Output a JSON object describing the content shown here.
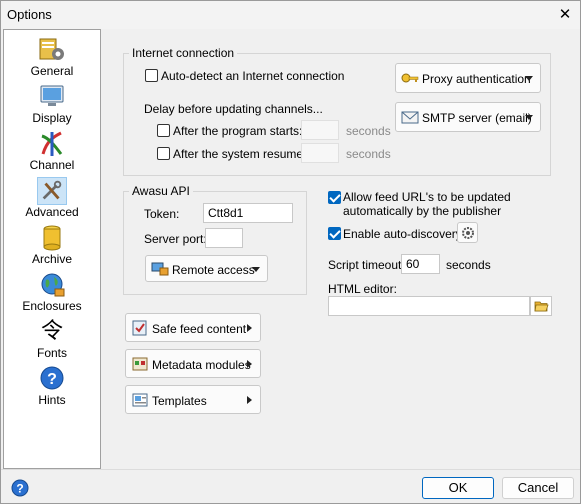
{
  "window": {
    "title": "Options"
  },
  "sidebar": {
    "items": [
      {
        "label": "General",
        "icon": "gear-folder-icon"
      },
      {
        "label": "Display",
        "icon": "monitor-icon"
      },
      {
        "label": "Channel",
        "icon": "channel-icon"
      },
      {
        "label": "Advanced",
        "icon": "tools-icon",
        "selected": true
      },
      {
        "label": "Archive",
        "icon": "archive-icon"
      },
      {
        "label": "Enclosures",
        "icon": "globe-icon"
      },
      {
        "label": "Fonts",
        "icon": "font-icon"
      },
      {
        "label": "Hints",
        "icon": "question-icon"
      }
    ]
  },
  "internet": {
    "group_label": "Internet connection",
    "autodetect_label": "Auto-detect an Internet connection",
    "delay_label": "Delay before updating channels...",
    "after_start_label": "After the program starts:",
    "after_resume_label": "After the system resumes:",
    "seconds_label": "seconds",
    "proxy_button": "Proxy authentication",
    "smtp_button": "SMTP server (email)"
  },
  "awasu_api": {
    "group_label": "Awasu API",
    "token_label": "Token:",
    "token_value": "Ctt8d1",
    "port_label": "Server port:",
    "port_value": "",
    "remote_button": "Remote access"
  },
  "options": {
    "allow_feed_label_line1": "Allow feed URL's to be updated",
    "allow_feed_label_line2": "automatically by the publisher",
    "autodiscovery_label": "Enable auto-discovery",
    "script_timeout_label": "Script timeout:",
    "script_timeout_value": "60",
    "seconds_label": "seconds",
    "html_editor_label": "HTML editor:",
    "html_editor_value": ""
  },
  "menus": {
    "safe_feed": "Safe feed content",
    "metadata": "Metadata modules",
    "templates": "Templates"
  },
  "footer": {
    "ok": "OK",
    "cancel": "Cancel"
  },
  "colors": {
    "accent": "#0067c0",
    "selection": "#cce4f7"
  }
}
